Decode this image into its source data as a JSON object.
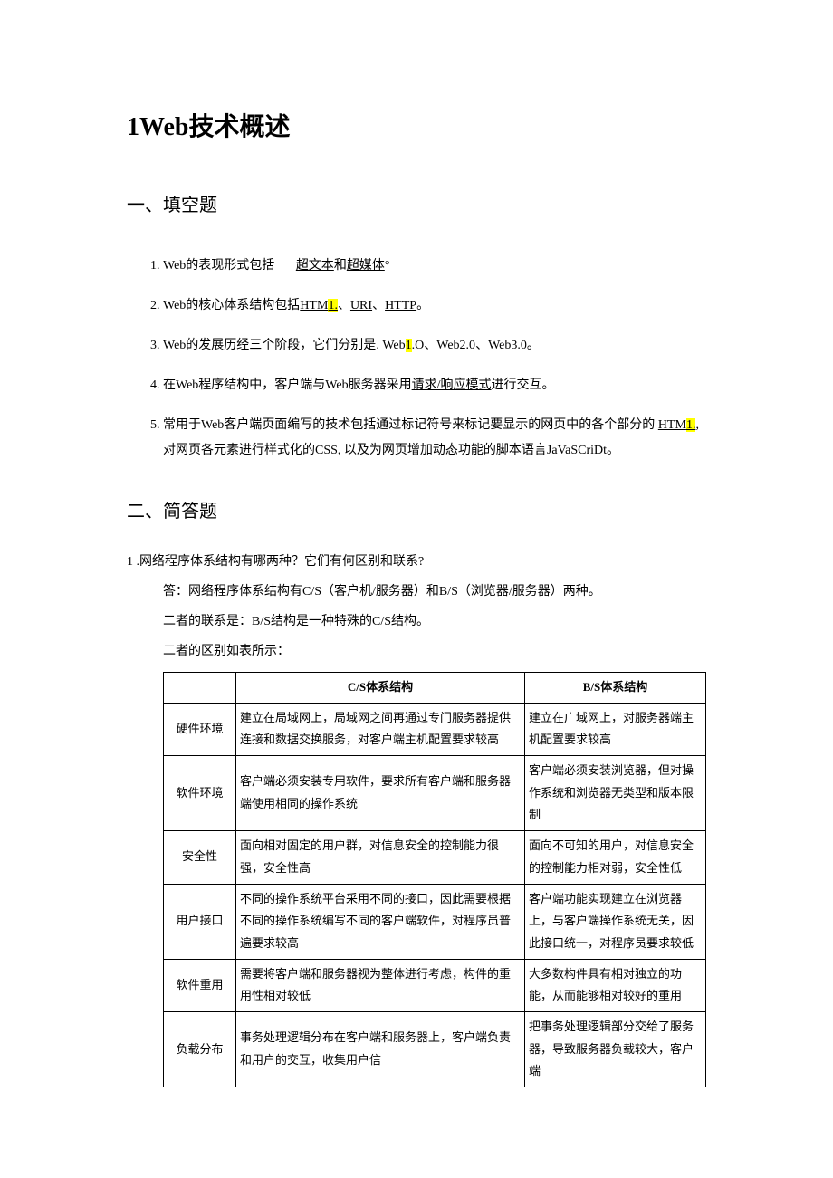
{
  "title": "1Web技术概述",
  "section1": "一、填空题",
  "fill": {
    "q1_pre": "Web的表现形式包括",
    "q1_a1": "超文本",
    "q1_mid": "和",
    "q1_a2": "超媒体",
    "q1_end": "°",
    "q2_pre": "Web的核心体系结构包括",
    "q2_a1a": "HTM",
    "q2_a1b": "1.",
    "q2_sep1": "、",
    "q2_a2": "URI",
    "q2_a3": "HTTP",
    "q2_end": "。",
    "q3_pre": "Web的发展历经三个阶段，它们分别是",
    "q3_a1a": ". Web",
    "q3_a1b": "1",
    "q3_a1c": ".O",
    "q3_sep": "、",
    "q3_a2": "Web2.0",
    "q3_a3": "Web3.0",
    "q3_end": "。",
    "q4_pre": "在Web程序结构中，客户端与Web服务器采用",
    "q4_a1": "请求/响应模式",
    "q4_end": "进行交互。",
    "q5_pre": "常用于Web客户端页面编写的技术包括通过标记符号来标记要显示的网页中的各个部分的",
    "q5_a1a": "HTM",
    "q5_a1b": "1.",
    "q5_mid1": ", 对网页各元素进行样式化的",
    "q5_a2": "CSS",
    "q5_mid2": ", 以及为网页增加动态功能的脚本语言",
    "q5_a3": "JaVaSCriDt",
    "q5_end": "。"
  },
  "section2": "二、简答题",
  "qa1": {
    "q": "1 .网络程序体系结构有哪两种？它们有何区别和联系?",
    "a1": "答：网络程序体系结构有C/S（客户机/服务器）和B/S（浏览器/服务器）两种。",
    "a2": "二者的联系是：B/S结构是一种特殊的C/S结构。",
    "a3": "二者的区别如表所示："
  },
  "table": {
    "header": {
      "c1": "",
      "c2": "C/S体系结构",
      "c3": "B/S体系结构"
    },
    "rows": [
      {
        "h": "硬件环境",
        "c2": "建立在局域网上，局域网之间再通过专门服务器提供连接和数据交换服务，对客户端主机配置要求较高",
        "c3": "建立在广域网上，对服务器端主机配置要求较高"
      },
      {
        "h": "软件环境",
        "c2": "客户端必须安装专用软件，要求所有客户端和服务器端使用相同的操作系统",
        "c3": "客户端必须安装浏览器，但对操作系统和浏览器无类型和版本限制"
      },
      {
        "h": "安全性",
        "c2": "面向相对固定的用户群，对信息安全的控制能力很强，安全性高",
        "c3": "面向不可知的用户，对信息安全的控制能力相对弱，安全性低"
      },
      {
        "h": "用户接口",
        "c2": "不同的操作系统平台采用不同的接口，因此需要根据不同的操作系统编写不同的客户端软件，对程序员普遍要求较高",
        "c3": "客户端功能实现建立在浏览器上，与客户端操作系统无关，因此接口统一，对程序员要求较低"
      },
      {
        "h": "软件重用",
        "c2": "需要将客户端和服务器视为整体进行考虑，构件的重用性相对较低",
        "c3": "大多数构件具有相对独立的功能，从而能够相对较好的重用"
      },
      {
        "h": "负载分布",
        "c2": "事务处理逻辑分布在客户端和服务器上，客户端负责和用户的交互，收集用户信",
        "c3": "把事务处理逻辑部分交给了服务器，导致服务器负载较大，客户端"
      }
    ]
  }
}
